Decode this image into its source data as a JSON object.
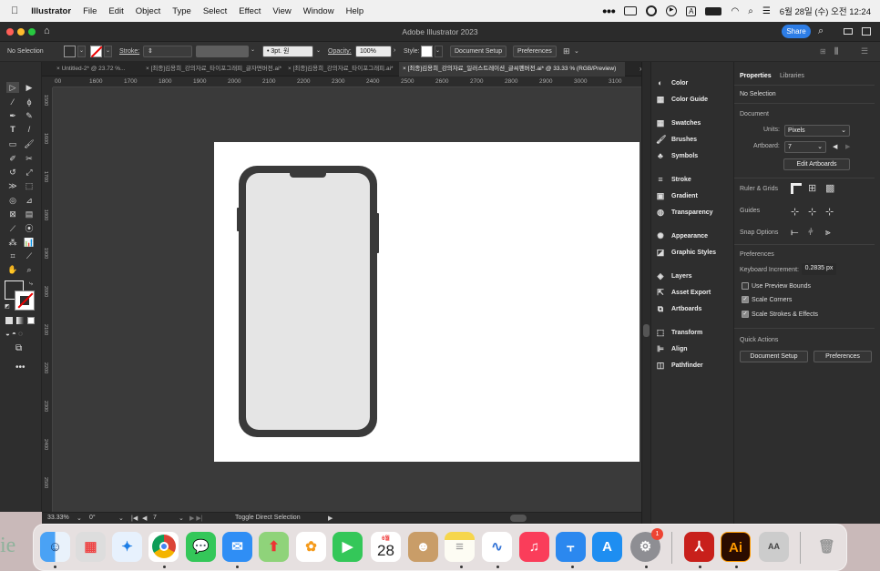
{
  "menubar": {
    "app": "Illustrator",
    "items": [
      "File",
      "Edit",
      "Object",
      "Type",
      "Select",
      "Effect",
      "View",
      "Window",
      "Help"
    ],
    "datetime": "6월 28일 (수) 오전 12:24",
    "input_icon": "A"
  },
  "window": {
    "title": "Adobe Illustrator 2023",
    "share": "Share"
  },
  "control": {
    "selection": "No Selection",
    "stroke_label": "Stroke:",
    "brush": "3pt. 원",
    "opacity_label": "Opacity:",
    "opacity_value": "100%",
    "style_label": "Style:",
    "document_setup": "Document Setup",
    "preferences": "Preferences"
  },
  "tabs": [
    {
      "label": "Untitled-2* @ 23.72 %...",
      "active": false
    },
    {
      "label": "[최종]김용희_강의자료_타이포그래피_글자면버전.ai*",
      "active": false
    },
    {
      "label": "[최종]김용희_강의자료_타이포그래피.ai*",
      "active": false
    },
    {
      "label": "[최종]김용희_강의자료_일러스트레이션_글씨펜버전.ai* @ 33.33 % (RGB/Preview)",
      "active": true
    }
  ],
  "ruler": {
    "h": [
      "00",
      "1600",
      "1700",
      "1800",
      "1900",
      "2000",
      "2100",
      "2200",
      "2300",
      "2400",
      "2500",
      "2600",
      "2700",
      "2800",
      "2900",
      "3000",
      "3100",
      "320"
    ],
    "v": [
      "1500",
      "1600",
      "1700",
      "1800",
      "1900",
      "2000",
      "2100",
      "2200",
      "2300",
      "2400",
      "2500"
    ]
  },
  "status": {
    "zoom": "33.33%",
    "rotate": "0°",
    "artboard": "7",
    "tool": "Toggle Direct Selection"
  },
  "panels": [
    "Color",
    "Color Guide",
    "Swatches",
    "Brushes",
    "Symbols",
    "Stroke",
    "Gradient",
    "Transparency",
    "Appearance",
    "Graphic Styles",
    "Layers",
    "Asset Export",
    "Artboards",
    "Transform",
    "Align",
    "Pathfinder"
  ],
  "properties": {
    "tab_properties": "Properties",
    "tab_libraries": "Libraries",
    "selection": "No Selection",
    "document": "Document",
    "units_label": "Units:",
    "units_value": "Pixels",
    "artboard_label": "Artboard:",
    "artboard_value": "7",
    "edit_artboards": "Edit Artboards",
    "ruler_grids": "Ruler & Grids",
    "guides": "Guides",
    "snap_options": "Snap Options",
    "preferences": "Preferences",
    "kb_label": "Keyboard Increment:",
    "kb_value": "0.2835 px",
    "use_preview": "Use Preview Bounds",
    "scale_corners": "Scale Corners",
    "scale_strokes": "Scale Strokes & Effects",
    "quick_actions": "Quick Actions",
    "qa_document_setup": "Document Setup",
    "qa_preferences": "Preferences"
  },
  "dock": {
    "calendar_month": "6월",
    "calendar_day": "28",
    "badge": "1",
    "partial_text": "ie"
  }
}
